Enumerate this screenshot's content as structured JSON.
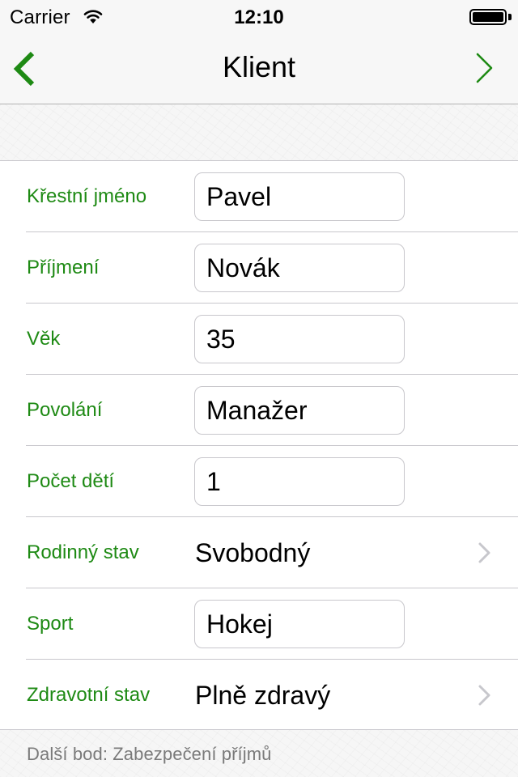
{
  "status": {
    "carrier": "Carrier",
    "time": "12:10",
    "wifi_icon": "wifi-icon",
    "battery_icon": "battery-icon"
  },
  "nav": {
    "title": "Klient",
    "back_icon": "chevron-left-icon",
    "next_icon": "chevron-right-icon",
    "accent_color": "#1e8a14"
  },
  "form": {
    "rows": [
      {
        "label": "Křestní jméno",
        "type": "input",
        "value": "Pavel"
      },
      {
        "label": "Příjmení",
        "type": "input",
        "value": "Novák"
      },
      {
        "label": "Věk",
        "type": "input",
        "value": "35"
      },
      {
        "label": "Povolání",
        "type": "input",
        "value": "Manažer"
      },
      {
        "label": "Počet dětí",
        "type": "input",
        "value": "1"
      },
      {
        "label": "Rodinný stav",
        "type": "select",
        "value": "Svobodný"
      },
      {
        "label": "Sport",
        "type": "input",
        "value": "Hokej"
      },
      {
        "label": "Zdravotní stav",
        "type": "select",
        "value": "Plně zdravý"
      }
    ]
  },
  "footer": {
    "next_item": "Další bod: Zabezpečení příjmů"
  }
}
